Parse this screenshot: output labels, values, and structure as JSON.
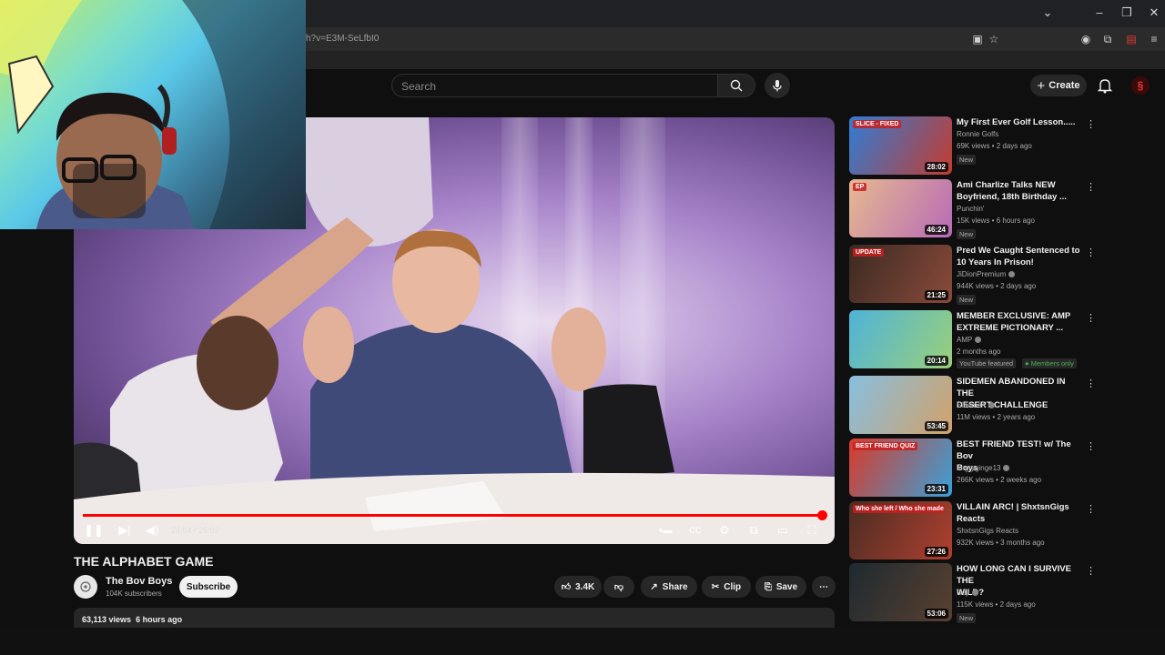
{
  "browser": {
    "url": "h?v=E3M-SeLfbI0",
    "window_controls": {
      "dropdown": "⌄",
      "minimize": "–",
      "maximize": "❐",
      "close": "✕"
    }
  },
  "header": {
    "search_placeholder": "Search",
    "create_label": "Create"
  },
  "player": {
    "current_time": "24:54",
    "duration": "25:02",
    "time_display": "24:54 / 25:02",
    "progress_fraction": 0.995
  },
  "video": {
    "title": "THE ALPHABET GAME",
    "channel": "The Bov Boys",
    "subscribers": "104K subscribers",
    "subscribe_label": "Subscribe",
    "likes": "3.4K",
    "share_label": "Share",
    "clip_label": "Clip",
    "save_label": "Save",
    "views": "63,113 views",
    "age": "6 hours ago"
  },
  "recommendations": [
    {
      "title_line1": "My First Ever Golf Lesson.....",
      "title_line2": "",
      "channel": "Ronnie Golfs",
      "verified": false,
      "meta": "69K views • 2 days ago",
      "badge": "New",
      "badge2": "",
      "duration": "28:02",
      "thumb_colors": [
        "#2f7dd6",
        "#c43b2f"
      ],
      "thumb_label": "SLICE - FIXED"
    },
    {
      "title_line1": "Ami Charlize Talks NEW",
      "title_line2": "Boyfriend, 18th Birthday ...",
      "channel": "Punchin'",
      "verified": false,
      "meta": "15K views • 6 hours ago",
      "badge": "New",
      "badge2": "",
      "duration": "46:24",
      "thumb_colors": [
        "#e6b98f",
        "#b86bb7"
      ],
      "thumb_label": "EP"
    },
    {
      "title_line1": "Pred We Caught Sentenced to",
      "title_line2": "10 Years In Prison!",
      "channel": "JiDionPremium",
      "verified": true,
      "meta": "944K views • 2 days ago",
      "badge": "New",
      "badge2": "",
      "duration": "21:25",
      "thumb_colors": [
        "#3a2a22",
        "#8a4a3a"
      ],
      "thumb_label": "UPDATE"
    },
    {
      "title_line1": "MEMBER EXCLUSIVE: AMP",
      "title_line2": "EXTREME PICTIONARY ...",
      "channel": "AMP",
      "verified": true,
      "meta": "2 months ago",
      "badge": "YouTube featured",
      "badge2": "Members only",
      "duration": "20:14",
      "thumb_colors": [
        "#4fb3d9",
        "#9ad07a"
      ],
      "thumb_label": ""
    },
    {
      "title_line1": "SIDEMEN ABANDONED IN THE",
      "title_line2": "DESERT CHALLENGE",
      "channel": "Sidemen",
      "verified": true,
      "meta": "11M views • 2 years ago",
      "badge": "",
      "badge2": "",
      "duration": "53:45",
      "thumb_colors": [
        "#87bfe0",
        "#d2a16a"
      ],
      "thumb_label": ""
    },
    {
      "title_line1": "BEST FRIEND TEST! w/ The Bov",
      "title_line2": "Boys",
      "channel": "angryginge13",
      "verified": true,
      "meta": "266K views • 2 weeks ago",
      "badge": "",
      "badge2": "",
      "duration": "23:31",
      "thumb_colors": [
        "#d83a2a",
        "#39a1d8"
      ],
      "thumb_label": "BEST FRIEND QUIZ"
    },
    {
      "title_line1": "VILLAIN ARC! | ShxtsnGigs",
      "title_line2": "Reacts",
      "channel": "ShxtsnGigs Reacts",
      "verified": false,
      "meta": "932K views • 3 months ago",
      "badge": "",
      "badge2": "",
      "duration": "27:26",
      "thumb_colors": [
        "#4a2c22",
        "#b04030"
      ],
      "thumb_label": "Who she left / Who she made"
    },
    {
      "title_line1": "HOW LONG CAN I SURVIVE THE",
      "title_line2": "WILD?",
      "channel": "Deji",
      "verified": true,
      "meta": "115K views • 2 days ago",
      "badge": "New",
      "badge2": "",
      "duration": "53:06",
      "thumb_colors": [
        "#1e2a30",
        "#5a4030"
      ],
      "thumb_label": ""
    }
  ],
  "colors": {
    "background": "#0f0f0f",
    "accent_red": "#ff0000",
    "pill_bg": "#272727"
  },
  "icons": [
    "search-icon",
    "mic-icon",
    "plus-icon",
    "bell-icon",
    "like-icon",
    "dislike-icon",
    "share-icon",
    "scissors-icon",
    "bookmark-icon",
    "more-icon",
    "play-pause-icon",
    "next-icon",
    "volume-icon",
    "captions-icon",
    "settings-icon",
    "miniplayer-icon",
    "theater-icon",
    "fullscreen-icon"
  ]
}
